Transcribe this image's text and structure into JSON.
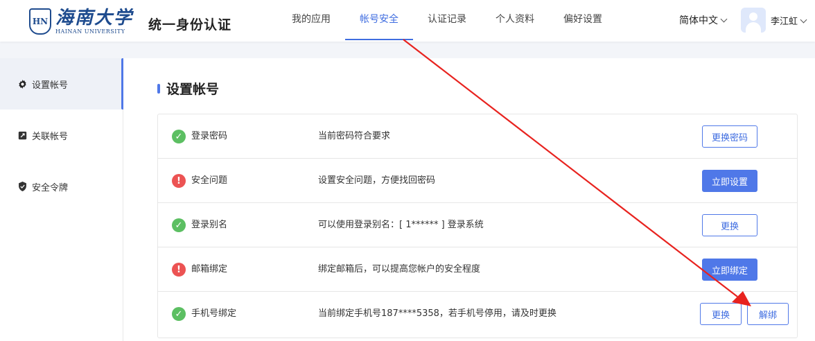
{
  "header": {
    "logo_cn": "海南大学",
    "logo_en": "HAINAN UNIVERSITY",
    "logo_seal": "HN",
    "app_title": "统一身份认证",
    "nav": [
      {
        "label": "我的应用",
        "active": false
      },
      {
        "label": "帐号安全",
        "active": true
      },
      {
        "label": "认证记录",
        "active": false
      },
      {
        "label": "个人资料",
        "active": false
      },
      {
        "label": "偏好设置",
        "active": false
      }
    ],
    "language": "简体中文",
    "user_name": "李江虹"
  },
  "sidebar": {
    "items": [
      {
        "label": "设置帐号",
        "icon": "gear-icon",
        "active": true
      },
      {
        "label": "关联帐号",
        "icon": "link-icon",
        "active": false
      },
      {
        "label": "安全令牌",
        "icon": "shield-icon",
        "active": false
      }
    ]
  },
  "main": {
    "title": "设置帐号",
    "rows": [
      {
        "label": "登录密码",
        "status": "ok",
        "desc": "当前密码符合要求",
        "buttons": [
          {
            "label": "更换密码",
            "style": "outline"
          }
        ]
      },
      {
        "label": "安全问题",
        "status": "warn",
        "desc": "设置安全问题，方便找回密码",
        "buttons": [
          {
            "label": "立即设置",
            "style": "primary"
          }
        ]
      },
      {
        "label": "登录别名",
        "status": "ok",
        "desc": "可以使用登录别名：[ 1****** ] 登录系统",
        "buttons": [
          {
            "label": "更换",
            "style": "outline"
          }
        ]
      },
      {
        "label": "邮箱绑定",
        "status": "warn",
        "desc": "绑定邮箱后，可以提高您帐户的安全程度",
        "buttons": [
          {
            "label": "立即绑定",
            "style": "primary"
          }
        ]
      },
      {
        "label": "手机号绑定",
        "status": "ok",
        "desc": "当前绑定手机号187****5358，若手机号停用，请及时更换",
        "buttons": [
          {
            "label": "更换",
            "style": "outline"
          },
          {
            "label": "解绑",
            "style": "outline"
          }
        ]
      }
    ]
  },
  "colors": {
    "accent": "#4f78e8",
    "ok": "#5cbf62",
    "warn": "#ec5353",
    "annotation": "#e8231f"
  }
}
